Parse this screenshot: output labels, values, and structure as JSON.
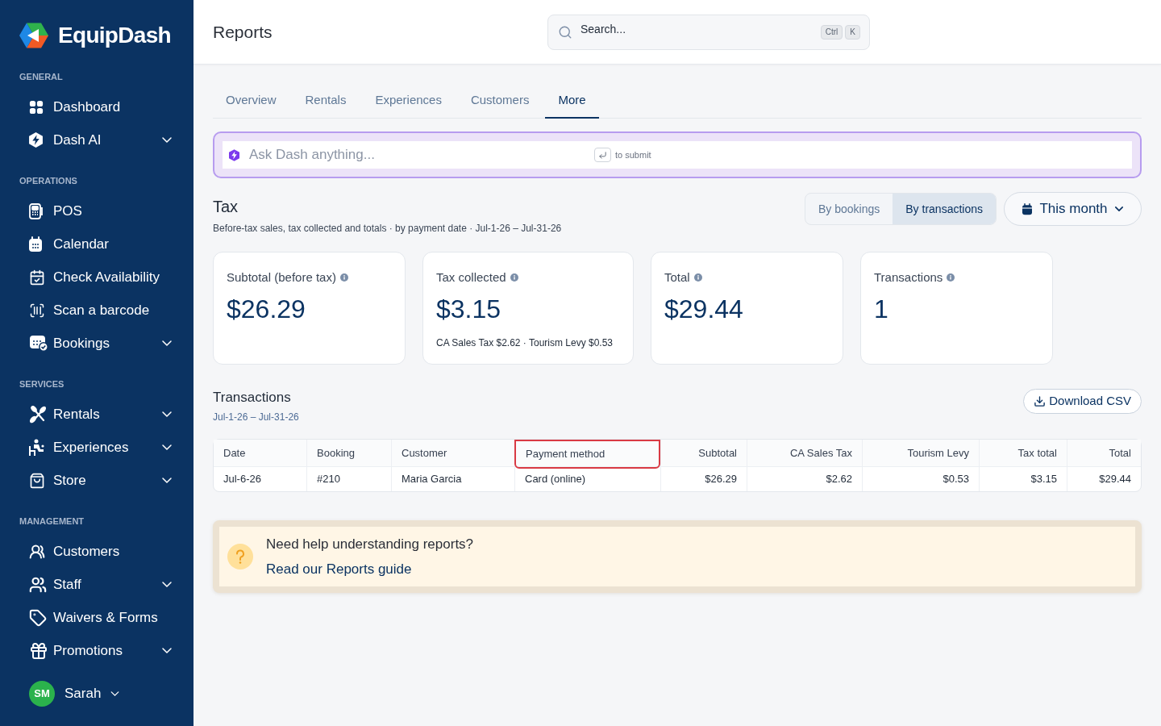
{
  "sidebar": {
    "brand": "EquipDash",
    "sections": [
      {
        "title": "GENERAL",
        "items": [
          {
            "label": "Dashboard",
            "kind": "link"
          },
          {
            "label": "Dash AI",
            "kind": "group"
          }
        ]
      },
      {
        "title": "OPERATIONS",
        "items": [
          {
            "label": "POS",
            "kind": "link"
          },
          {
            "label": "Calendar",
            "kind": "link"
          },
          {
            "label": "Check Availability",
            "kind": "link"
          },
          {
            "label": "Scan a barcode",
            "kind": "link"
          },
          {
            "label": "Bookings",
            "kind": "group"
          }
        ]
      },
      {
        "title": "SERVICES",
        "items": [
          {
            "label": "Rentals",
            "kind": "group"
          },
          {
            "label": "Experiences",
            "kind": "group"
          },
          {
            "label": "Store",
            "kind": "group"
          }
        ]
      },
      {
        "title": "MANAGEMENT",
        "items": [
          {
            "label": "Customers",
            "kind": "link"
          },
          {
            "label": "Staff",
            "kind": "group"
          },
          {
            "label": "Waivers & Forms",
            "kind": "link"
          },
          {
            "label": "Promotions",
            "kind": "group"
          }
        ]
      }
    ],
    "user": {
      "initials": "SM",
      "name": "Sarah"
    }
  },
  "header": {
    "title": "Reports",
    "search": {
      "placeholder": "Search...",
      "keys": [
        "Ctrl",
        "K"
      ]
    }
  },
  "tabs": [
    {
      "label": "Overview",
      "selected": false
    },
    {
      "label": "Rentals",
      "selected": false
    },
    {
      "label": "Experiences",
      "selected": false
    },
    {
      "label": "Customers",
      "selected": false
    },
    {
      "label": "More",
      "selected": true
    }
  ],
  "ask_dash": {
    "placeholder": "Ask Dash anything...",
    "hint": "to submit"
  },
  "tax": {
    "title": "Tax",
    "subtitle": "Before-tax sales, tax collected and totals · by payment date · Jul-1-26 – Jul-31-26",
    "modes": [
      {
        "label": "By bookings",
        "selected": false
      },
      {
        "label": "By transactions",
        "selected": true
      }
    ],
    "period": "This month",
    "cards": [
      {
        "label": "Subtotal (before tax)",
        "value": "$26.29"
      },
      {
        "label": "Tax collected",
        "value": "$3.15",
        "detail": "CA Sales Tax $2.62 · Tourism Levy $0.53"
      },
      {
        "label": "Total",
        "value": "$29.44"
      },
      {
        "label": "Transactions",
        "value": "1"
      }
    ]
  },
  "transactions": {
    "title": "Transactions",
    "range": "Jul-1-26 – Jul-31-26",
    "download": "Download CSV",
    "columns": [
      {
        "label": "Date",
        "kind": "text",
        "highlighted": false
      },
      {
        "label": "Booking",
        "kind": "text",
        "highlighted": false
      },
      {
        "label": "Customer",
        "kind": "text",
        "highlighted": false
      },
      {
        "label": "Payment method",
        "kind": "text",
        "highlighted": true
      },
      {
        "label": "Subtotal",
        "kind": "amount",
        "highlighted": false
      },
      {
        "label": "CA Sales Tax",
        "kind": "amount",
        "highlighted": false
      },
      {
        "label": "Tourism Levy",
        "kind": "amount",
        "highlighted": false
      },
      {
        "label": "Tax total",
        "kind": "amount",
        "highlighted": false
      },
      {
        "label": "Total",
        "kind": "amount",
        "highlighted": false
      }
    ],
    "rows": [
      {
        "cells": [
          "Jul-6-26",
          "#210",
          "Maria Garcia",
          "Card (online)",
          "$26.29",
          "$2.62",
          "$0.53",
          "$3.15",
          "$29.44"
        ]
      }
    ]
  },
  "help": {
    "title": "Need help understanding reports?",
    "link": "Read our Reports guide"
  }
}
